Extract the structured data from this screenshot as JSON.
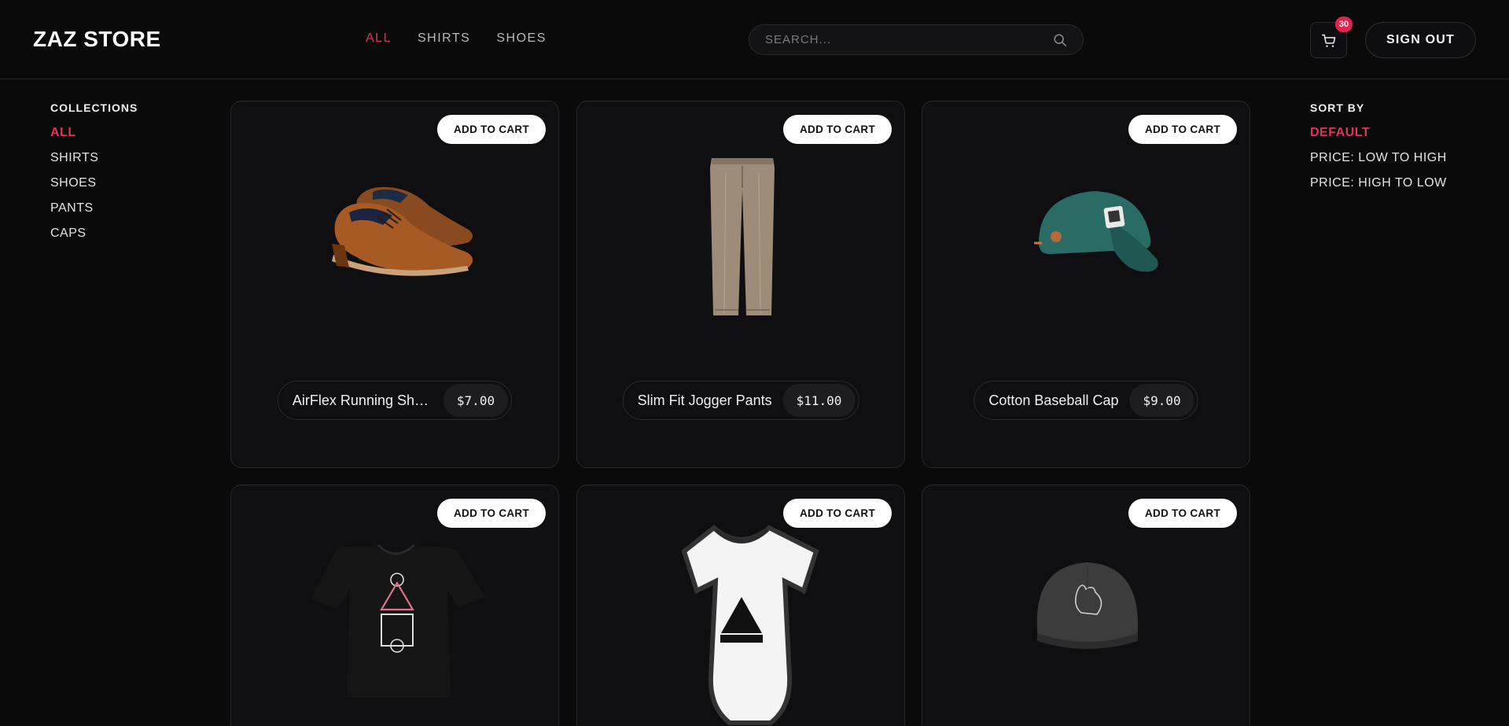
{
  "header": {
    "logo": "ZAZ STORE",
    "nav": [
      "ALL",
      "SHIRTS",
      "SHOES"
    ],
    "active_nav": "ALL",
    "search_placeholder": "SEARCH...",
    "cart_count": "30",
    "sign_out": "SIGN OUT"
  },
  "sidebar": {
    "title": "COLLECTIONS",
    "items": [
      "ALL",
      "SHIRTS",
      "SHOES",
      "PANTS",
      "CAPS"
    ],
    "active": "ALL"
  },
  "sort": {
    "title": "SORT BY",
    "items": [
      "DEFAULT",
      "PRICE: LOW TO HIGH",
      "PRICE: HIGH TO LOW"
    ],
    "active": "DEFAULT"
  },
  "products": [
    {
      "name": "AirFlex Running Sho...",
      "price": "$7.00",
      "add_label": "ADD TO CART",
      "image": "brown-oxford-shoes"
    },
    {
      "name": "Slim Fit Jogger Pants",
      "price": "$11.00",
      "add_label": "ADD TO CART",
      "image": "beige-trousers"
    },
    {
      "name": "Cotton Baseball Cap",
      "price": "$9.00",
      "add_label": "ADD TO CART",
      "image": "teal-baseball-cap"
    },
    {
      "name": "",
      "price": "",
      "add_label": "ADD TO CART",
      "image": "black-kids-tshirt-shapes"
    },
    {
      "name": "",
      "price": "",
      "add_label": "ADD TO CART",
      "image": "white-baby-onesie-triangle"
    },
    {
      "name": "",
      "price": "",
      "add_label": "ADD TO CART",
      "image": "grey-washed-cap-cat"
    }
  ],
  "colors": {
    "accent": "#e0335a",
    "background": "#0a0a0b",
    "card": "#0f0f11"
  }
}
